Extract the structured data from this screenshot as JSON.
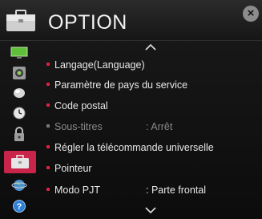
{
  "header": {
    "title": "OPTION",
    "close_glyph": "×"
  },
  "sidebar": {
    "items": [
      {
        "icon": "picture-icon"
      },
      {
        "icon": "sound-icon"
      },
      {
        "icon": "channel-icon"
      },
      {
        "icon": "time-icon"
      },
      {
        "icon": "lock-icon"
      },
      {
        "icon": "option-briefcase-icon",
        "active": true
      },
      {
        "icon": "network-globe-icon"
      },
      {
        "icon": "support-question-icon"
      }
    ]
  },
  "menu": {
    "items": [
      {
        "label": "Langage(Language)",
        "value": "",
        "enabled": true
      },
      {
        "label": "Paramètre de pays du service",
        "value": "",
        "enabled": true
      },
      {
        "label": "Code postal",
        "value": "",
        "enabled": true
      },
      {
        "label": "Sous-titres",
        "value": ": Arrêt",
        "enabled": false
      },
      {
        "label": "Régler la télécommande universelle",
        "value": "",
        "enabled": true
      },
      {
        "label": "Pointeur",
        "value": "",
        "enabled": true
      },
      {
        "label": "Modo PJT",
        "value": ": Parte frontal",
        "enabled": true
      }
    ]
  },
  "colors": {
    "accent": "#c9254a",
    "bullet": "#e0223f",
    "text": "#e8e8e8",
    "disabled_text": "#8a8a8a",
    "background": "#111111"
  }
}
